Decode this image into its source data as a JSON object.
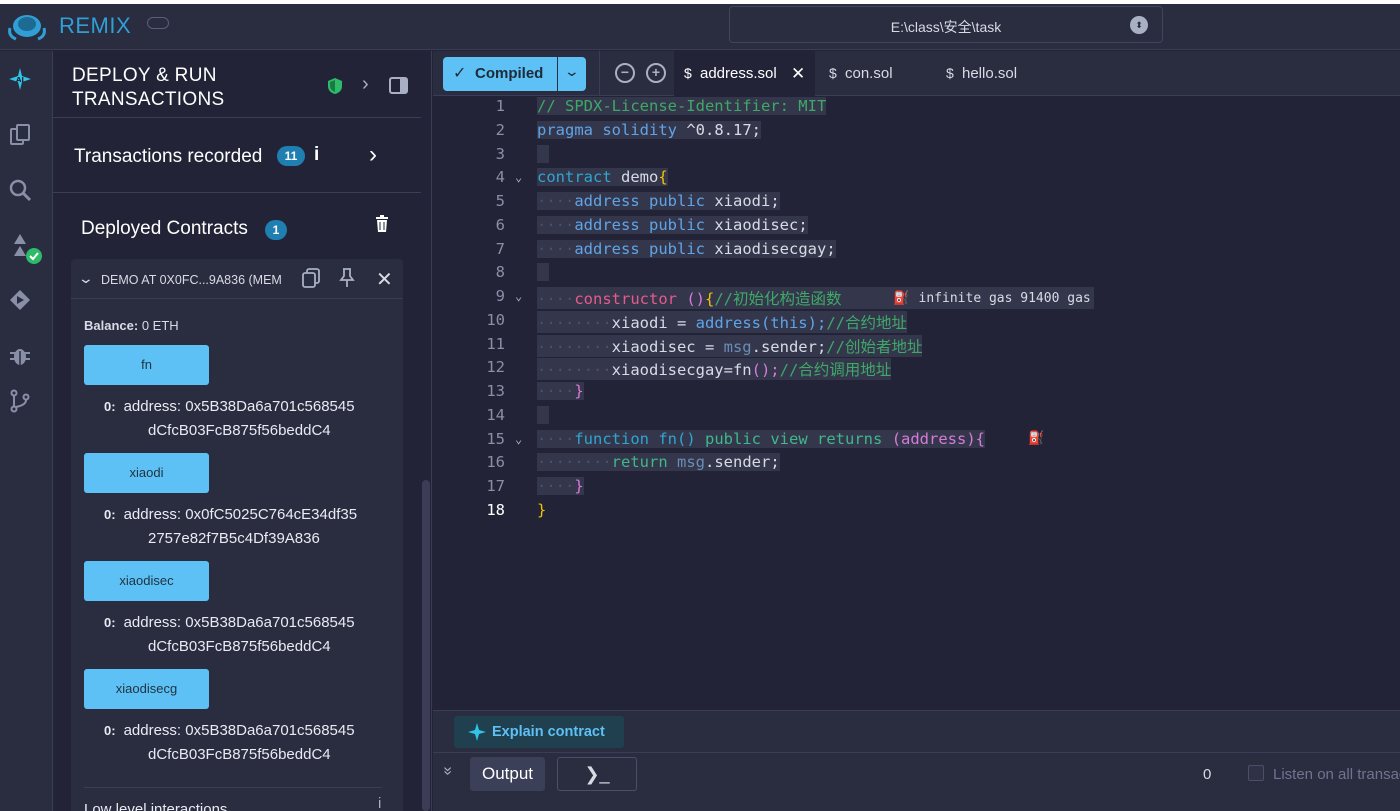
{
  "topbar": {
    "app_name": "REMIX",
    "workspace_path": "E:\\class\\安全\\task"
  },
  "rail": {
    "icons": [
      "ai-icon",
      "file-explorer-icon",
      "search-icon",
      "solidity-compiler-icon",
      "deploy-run-icon",
      "debugger-icon",
      "git-icon"
    ]
  },
  "panel": {
    "title_line1": "DEPLOY & RUN",
    "title_line2": "TRANSACTIONS",
    "transactions_label": "Transactions recorded",
    "transactions_count": "11",
    "deployed_label": "Deployed Contracts",
    "deployed_count": "1",
    "contract_name": "DEMO AT 0X0FC...9A836 (MEM",
    "balance_label": "Balance:",
    "balance_value": "0 ETH",
    "functions": [
      {
        "name": "fn",
        "result_index": "0:",
        "result_line1": "address: 0x5B38Da6a701c568545",
        "result_line2": "dCfcB03FcB875f56beddC4"
      },
      {
        "name": "xiaodi",
        "result_index": "0:",
        "result_line1": "address: 0x0fC5025C764cE34df35",
        "result_line2": "2757e82f7B5c4Df39A836"
      },
      {
        "name": "xiaodisec",
        "result_index": "0:",
        "result_line1": "address: 0x5B38Da6a701c568545",
        "result_line2": "dCfcB03FcB875f56beddC4"
      },
      {
        "name": "xiaodisecg",
        "result_index": "0:",
        "result_line1": "address: 0x5B38Da6a701c568545",
        "result_line2": "dCfcB03FcB875f56beddC4"
      }
    ],
    "low_level_label": "Low level interactions"
  },
  "editor": {
    "compiled_label": "Compiled",
    "tabs": [
      "address.sol",
      "con.sol",
      "hello.sol"
    ],
    "active_tab": "address.sol",
    "line_numbers": [
      "1",
      "2",
      "3",
      "4",
      "5",
      "6",
      "7",
      "8",
      "9",
      "10",
      "11",
      "12",
      "13",
      "14",
      "15",
      "16",
      "17",
      "18"
    ],
    "current_line": "18",
    "code": {
      "l1": "// SPDX-License-Identifier: MIT",
      "l2_kw": "pragma",
      "l2_kw2": "solidity",
      "l2_ver": "^0.8.17;",
      "l4_kw": "contract",
      "l4_name": "demo",
      "l5_name": "xiaodi;",
      "l6_name": "xiaodisec;",
      "l7_name": "xiaodisecgay;",
      "kw_address": "address",
      "kw_public": "public",
      "l9_ctor": "constructor",
      "l9_comment": "//初始化构造函数",
      "gas_estimate": "infinite gas 91400 gas",
      "l10_lhs": "xiaodi = ",
      "l10_call": "address(this);",
      "l10_comment": "//合约地址",
      "l11_lhs": "xiaodisec = ",
      "l11_msg": "msg",
      "l11_rest": ".sender;",
      "l11_comment": "//创始者地址",
      "l12_lhs": "xiaodisecgay=fn",
      "l12_paren": "();",
      "l12_comment": "//合约调用地址",
      "l15_fn": "function",
      "l15_name": "fn()",
      "l15_public": "public",
      "l15_view": "view",
      "l15_returns": "returns",
      "l15_ret": "(address){",
      "l16_return": "return",
      "l16_msg": "msg",
      "l16_rest": ".sender;",
      "close_brace": "}"
    }
  },
  "bottom": {
    "explain_label": "Explain contract",
    "output_label": "Output",
    "terminal_glyph": "❯_",
    "pending_count": "0",
    "listen_label": "Listen on all transactions"
  }
}
